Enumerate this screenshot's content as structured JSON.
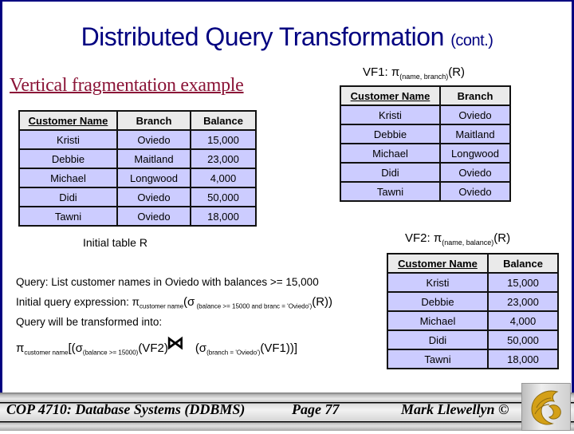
{
  "title": {
    "main": "Distributed Query Transformation",
    "suffix": "(cont.)"
  },
  "subheading": "Vertical fragmentation example",
  "table_r": {
    "columns": [
      "Customer Name",
      "Branch",
      "Balance"
    ],
    "rows": [
      [
        "Kristi",
        "Oviedo",
        "15,000"
      ],
      [
        "Debbie",
        "Maitland",
        "23,000"
      ],
      [
        "Michael",
        "Longwood",
        "4,000"
      ],
      [
        "Didi",
        "Oviedo",
        "50,000"
      ],
      [
        "Tawni",
        "Oviedo",
        "18,000"
      ]
    ],
    "caption": "Initial table R"
  },
  "vf1": {
    "label_prefix": "VF1: π",
    "label_sub": "(name, branch)",
    "label_suffix": "(R)",
    "columns": [
      "Customer Name",
      "Branch"
    ],
    "rows": [
      [
        "Kristi",
        "Oviedo"
      ],
      [
        "Debbie",
        "Maitland"
      ],
      [
        "Michael",
        "Longwood"
      ],
      [
        "Didi",
        "Oviedo"
      ],
      [
        "Tawni",
        "Oviedo"
      ]
    ]
  },
  "vf2": {
    "label_prefix": "VF2: π",
    "label_sub": "(name, balance)",
    "label_suffix": "(R)",
    "columns": [
      "Customer Name",
      "Balance"
    ],
    "rows": [
      [
        "Kristi",
        "15,000"
      ],
      [
        "Debbie",
        "23,000"
      ],
      [
        "Michael",
        "4,000"
      ],
      [
        "Didi",
        "50,000"
      ],
      [
        "Tawni",
        "18,000"
      ]
    ]
  },
  "query": {
    "line1": "Query: List customer names in Oviedo with balances >= 15,000",
    "line2_prefix": "Initial query expression: π",
    "line2_sub1": "customer name",
    "line2_mid": "(σ",
    "line2_sub2": " (balance >= 15000 and branc = 'Oviedo')",
    "line2_suffix": "(R))",
    "line3": "Query will be transformed into:",
    "line4_pi": "π",
    "line4_sub1": "customer name",
    "line4_a": "[(σ",
    "line4_sub2": "(balance >= 15000)",
    "line4_b": "(VF2)",
    "join_symbol": "⋈",
    "line4_c": "(σ",
    "line4_sub3": "(branch = 'Oviedo')",
    "line4_d": "(VF1))]"
  },
  "footer": {
    "course": "COP 4710: Database Systems  (DDBMS)",
    "page": "Page 77",
    "author": "Mark Llewellyn ©",
    "logo": "ucf-pegasus-logo"
  },
  "colors": {
    "frame": "#000080",
    "title": "#000080",
    "subheading": "#8B1538",
    "row_bg": "#CCCCFF",
    "header_bg": "#EAEAEA",
    "logo_gold": "#D4A017"
  }
}
